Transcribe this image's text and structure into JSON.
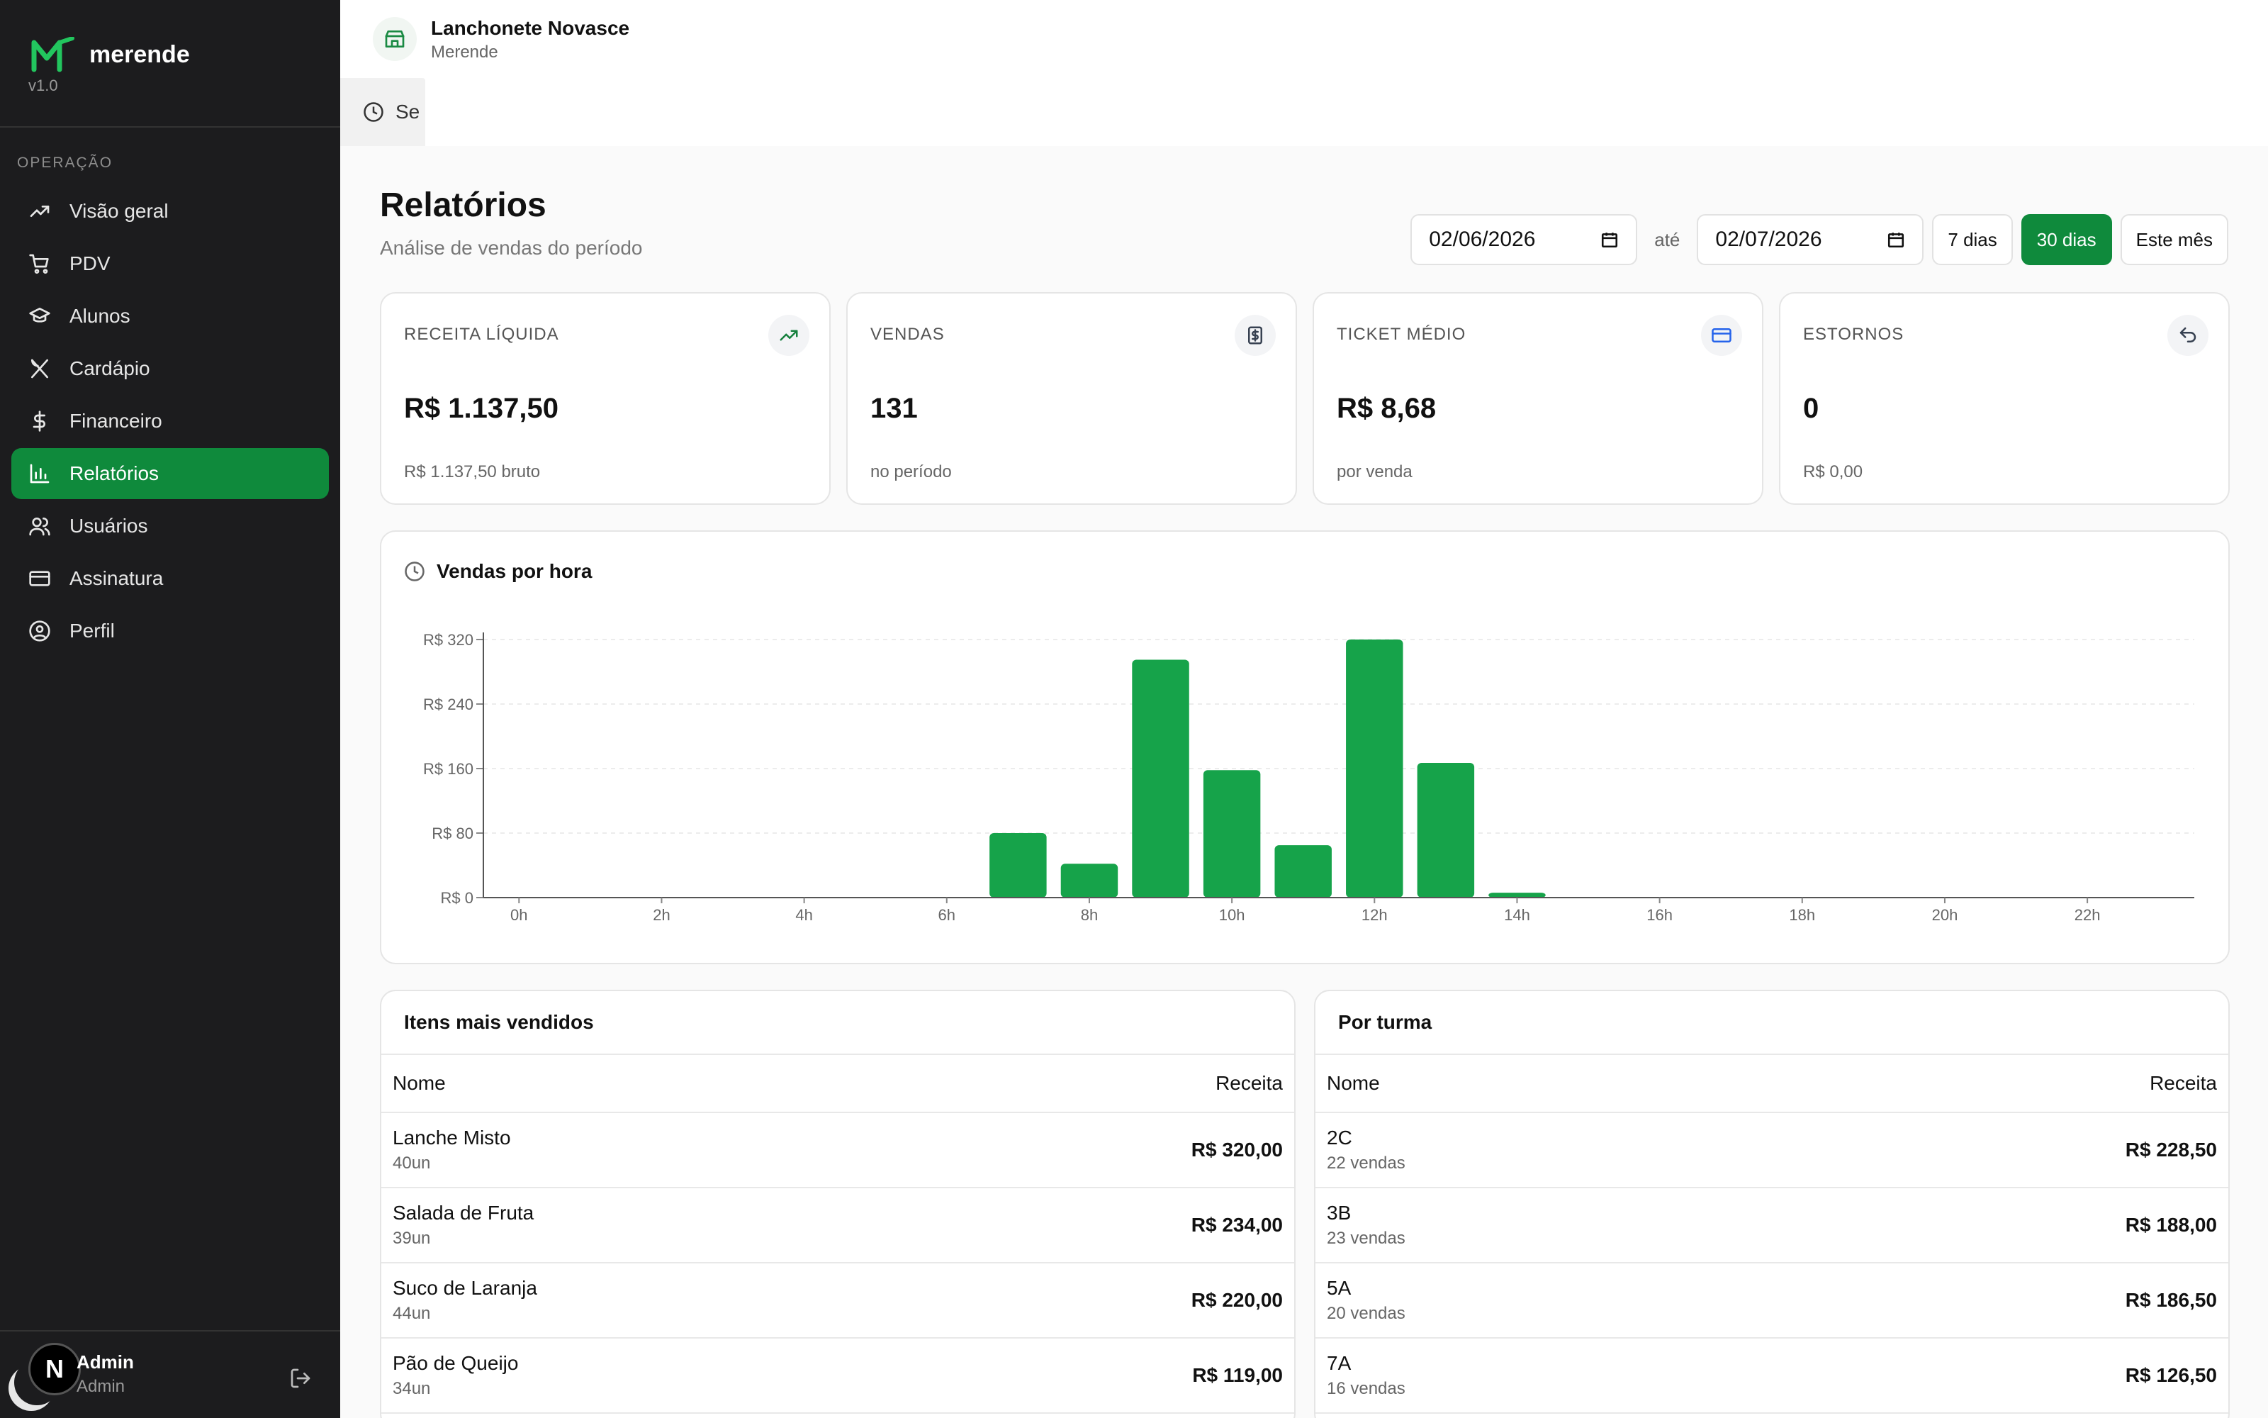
{
  "brand": {
    "name": "merende",
    "version": "v1.0",
    "logo_color": "#22c55e"
  },
  "sidebar": {
    "section_label": "OPERAÇÃO",
    "items": [
      {
        "label": "Visão geral",
        "icon": "trending-up-icon"
      },
      {
        "label": "PDV",
        "icon": "cart-icon"
      },
      {
        "label": "Alunos",
        "icon": "graduation-cap-icon"
      },
      {
        "label": "Cardápio",
        "icon": "utensils-icon"
      },
      {
        "label": "Financeiro",
        "icon": "dollar-icon"
      },
      {
        "label": "Relatórios",
        "icon": "bar-chart-icon",
        "active": true
      },
      {
        "label": "Usuários",
        "icon": "users-icon"
      },
      {
        "label": "Assinatura",
        "icon": "credit-card-icon"
      },
      {
        "label": "Perfil",
        "icon": "user-circle-icon"
      }
    ],
    "footer": {
      "avatar_letter": "N",
      "user_name": "Admin",
      "user_role": "Admin"
    }
  },
  "topbar": {
    "store_name": "Lanchonete Novasce",
    "store_sub": "Merende",
    "session_tab_label": "Se"
  },
  "page": {
    "title": "Relatórios",
    "subtitle": "Análise de vendas do período"
  },
  "filters": {
    "date_from": "02/06/2026",
    "until_label": "até",
    "date_to": "02/07/2026",
    "presets": [
      "7 dias",
      "30 dias",
      "Este mês"
    ],
    "active_preset": "30 dias"
  },
  "kpis": [
    {
      "label": "RECEITA LÍQUIDA",
      "value": "R$ 1.137,50",
      "foot": "R$ 1.137,50 bruto",
      "icon": "trending-up-icon",
      "color": "#15803d"
    },
    {
      "label": "VENDAS",
      "value": "131",
      "foot": "no período",
      "icon": "receipt-icon",
      "color": "#374151"
    },
    {
      "label": "TICKET MÉDIO",
      "value": "R$ 8,68",
      "foot": "por venda",
      "icon": "credit-card-icon",
      "color": "#2563eb"
    },
    {
      "label": "ESTORNOS",
      "value": "0",
      "foot": "R$ 0,00",
      "icon": "undo-icon",
      "color": "#374151"
    }
  ],
  "chart_data": {
    "type": "bar",
    "title": "Vendas por hora",
    "x_tick_labels": [
      "0h",
      "2h",
      "4h",
      "6h",
      "8h",
      "10h",
      "12h",
      "14h",
      "16h",
      "18h",
      "20h",
      "22h"
    ],
    "categories": [
      "0h",
      "1h",
      "2h",
      "3h",
      "4h",
      "5h",
      "6h",
      "7h",
      "8h",
      "9h",
      "10h",
      "11h",
      "12h",
      "13h",
      "14h",
      "15h",
      "16h",
      "17h",
      "18h",
      "19h",
      "20h",
      "21h",
      "22h",
      "23h"
    ],
    "values": [
      0,
      0,
      0,
      0,
      0,
      0,
      0,
      80,
      42,
      295,
      158,
      65,
      320,
      167,
      6,
      0,
      0,
      0,
      0,
      0,
      0,
      0,
      0,
      0
    ],
    "y_ticks": [
      "R$ 0",
      "R$ 80",
      "R$ 160",
      "R$ 240",
      "R$ 320"
    ],
    "ylim": [
      0,
      320
    ],
    "grid": true,
    "bar_color": "#16a34a"
  },
  "top_items": {
    "title": "Itens mais vendidos",
    "col_name": "Nome",
    "col_revenue": "Receita",
    "rows": [
      {
        "name": "Lanche Misto",
        "sub": "40un",
        "amount": "R$ 320,00"
      },
      {
        "name": "Salada de Fruta",
        "sub": "39un",
        "amount": "R$ 234,00"
      },
      {
        "name": "Suco de Laranja",
        "sub": "44un",
        "amount": "R$ 220,00"
      },
      {
        "name": "Pão de Queijo",
        "sub": "34un",
        "amount": "R$ 119,00"
      }
    ]
  },
  "by_class": {
    "title": "Por turma",
    "col_name": "Nome",
    "col_revenue": "Receita",
    "rows": [
      {
        "name": "2C",
        "sub": "22 vendas",
        "amount": "R$ 228,50"
      },
      {
        "name": "3B",
        "sub": "23 vendas",
        "amount": "R$ 188,00"
      },
      {
        "name": "5A",
        "sub": "20 vendas",
        "amount": "R$ 186,50"
      },
      {
        "name": "7A",
        "sub": "16 vendas",
        "amount": "R$ 126,50"
      }
    ]
  }
}
